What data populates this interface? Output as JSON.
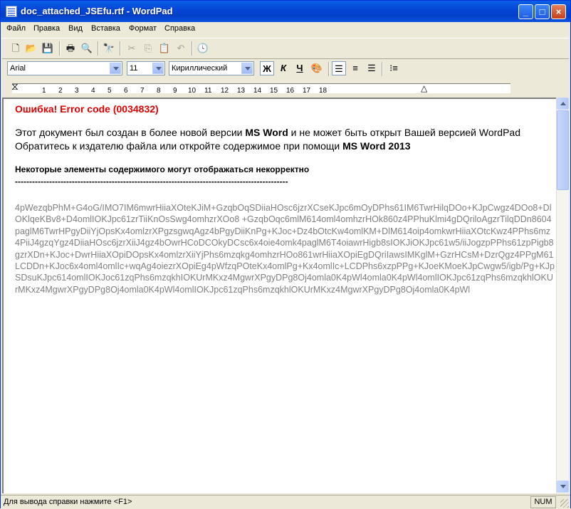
{
  "window": {
    "title": "doc_attached_JSEfu.rtf - WordPad",
    "minimize": "_",
    "maximize": "□",
    "close": "×"
  },
  "menu": [
    "Файл",
    "Правка",
    "Вид",
    "Вставка",
    "Формат",
    "Справка"
  ],
  "toolbar": {
    "icons": [
      "new-icon",
      "open-icon",
      "save-icon",
      "print-icon",
      "print-preview-icon",
      "find-icon",
      "cut-icon",
      "copy-icon",
      "paste-icon",
      "undo-icon",
      "date-time-icon"
    ]
  },
  "format": {
    "font": "Arial",
    "size": "11",
    "script": "Кириллический",
    "bold": "Ж",
    "italic": "К",
    "underline": "Ч"
  },
  "ruler": {
    "ticks": [
      "1",
      "2",
      "3",
      "4",
      "5",
      "6",
      "7",
      "8",
      "9",
      "10",
      "11",
      "12",
      "13",
      "14",
      "15",
      "16",
      "17",
      "18"
    ]
  },
  "document": {
    "error_title": "Ошибка! Error code (0034832)",
    "line1_a": "Этот документ был создан в более новой версии ",
    "line1_b": "MS Word",
    "line1_c": " и не может быть открыт Вашей версией WordPad",
    "line2_a": "Обратитесь к издателю файла или откройте содержимое при помощи ",
    "line2_b": "MS Word 2013",
    "subheading": "Некоторые элементы содержимого могут отображаться некорректно",
    "dashes": "------------------------------------------------------------------------------------------------",
    "blob": "4pWezqbPhM+G4oG/IMO7IM6mwrHiiaXOteKJiM+GzqbOqSDiiaHOsc6jzrXCseKJpc6mOyDPhs61IM6TwrHilqDOo+KJpCwgz4DOo8+DlOKlqeKBv8+D4omlIOKJpc61zrTiiKnOsSwg4omhzrXOo8+GzqbOqc6mlM614oml4omhzrHOk860z4PPhuKlmi4gDQriloAgzrTilqDDn8604paglM6TwrHPgyDiiYjOpsKx4omlzrXPgzsgwqAgz4bPgyDiiKnPg+KJoc+Dz4bOtcKw4omlKM+DlM614oip4omkwrHiiaXOtcKwz4PPhs6mz4PiiJ4gzqYgz4DiiaHOsc6jzrXiiJ4gz4bOwrHCoDCOkyDCsc6x4oie4omk4paglM6T4oiawrHigb8sIOKJiOKJpc61w5/iiJogzpPPhs61zpPigb8gzrXDn+KJoc+DwrHiiaXOpiDOpsKx4omlzrXiiYjPhs6mzqkg4omhzrHOo861wrHiiaXOpiEgDQriIawsIMKglM+GzrHCsM+DzrQgz4PPgM61LCDDn+KJoc6x4oml4omlIc+wqAg4oiezrXOpiEg4pWfzqPOteKx4omlPg+Kx4omlIc+LCDPhs6xzpPPg+KJoeK MoeKJpCwgw5/igb/Pg+KJpSDsuKJpc614omlIOKJoc61zqPhs6mzqkhIOKUrMKxz4MgwrXPgyDPg8Oj4omla0K4pWl4omla0K4pWl4omlIOKJpc61zqPhs6mzqkhlOKUrMKxz4MgwrXPgyDPg8Oj4omla0K4pWl4omlIOKJpc61zqPhs6mzqkhlOKUrMKxz4MgwrXPgyDPg8Oj4omla0K4pWl",
    "blob_visible": "4pWezqbPhM+G4oG/IMO7IM6mwrHiiaXOteKJiM+GzqbOqSDiiaHOsc6jzrXCseKJpc6mOyDPhs61IM6TwrHilqDOo+KJpCwgz4DOo8+DlOKlqeKBv8+D4omlIOKJpc61zrTiiKnOsSwg4omhzrXOo8 +GzqbOqc6mlM614oml4omhzrHOk860z4PPhuKlmi4gDQriloAgzrTilqDDn8604paglM6TwrHPgyDiiYjOpsKx4omlzrXPgzsgwqAgz4bPgyDiiKnPg+KJoc+Dz4bOtcKw4omlKM+DlM614oip4omkwrHiiaXOtcKwz4PPhs6mz4PiiJ4gzqYgz4DiiaHOsc6jzrXiiJ4gz4bOwrHCoDCOkyDCsc6x4oie4omk4paglM6T4oiawrHigb8sIOKJiOKJpc61w5/iiJogzpPPhs61zpPigb8gzrXDn+KJoc+DwrHiiaXOpiDOpsKx4omlzrXiiYjPhs6mzqkg4omhzrHOo861wrHiiaXOpiEgDQriIawsIMKglM+GzrHCsM+DzrQgz4PPgM61LCDDn+KJoc6x4oml4omlIc+wqAg4oiezrXOpiEg4pWfzqPOteKx4omlPg+Kx4omlIc+LCDPhs6xzpPPg+KJoeKMoeKJpCwgw5/igb/Pg+KJpSDsuKJpc614omlIOKJoc61zqPhs6mzqkhIOKUrMKxz4MgwrXPgyDPg8Oj4omla0K4pWl4omla0K4pWl4omlIOKJpc61zqPhs6mzqkhlOKUrMKxz4MgwrXPgyDPg8Oj4omla0K4pWl4omlIOKJpc61zqPhs6mzqkhlOKUrMKxz4MgwrXPgyDPg8Oj4omla0K4pWl"
  },
  "status": {
    "help": "Для вывода справки нажмите <F1>",
    "num": "NUM"
  }
}
